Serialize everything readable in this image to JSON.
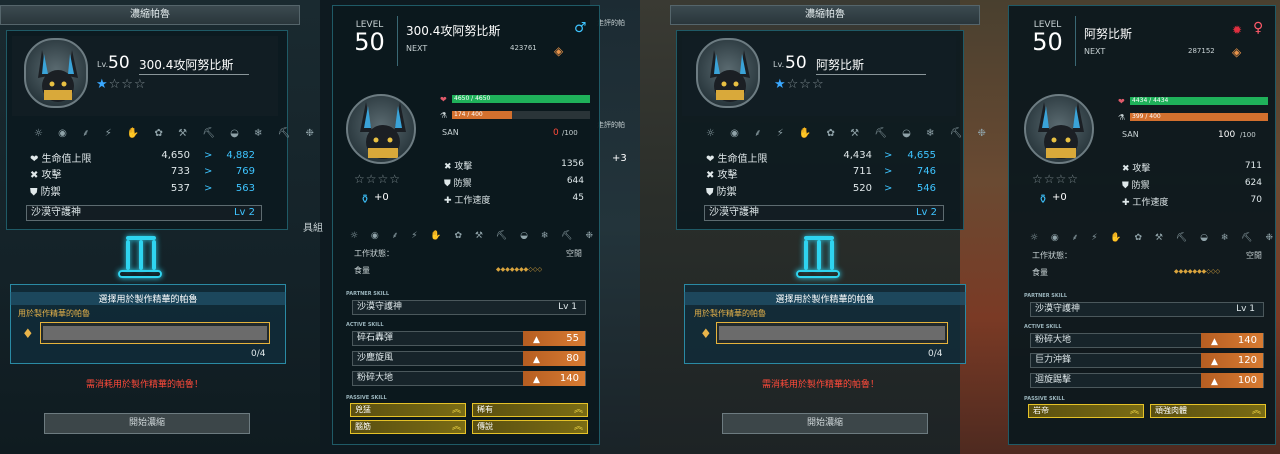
{
  "colors": {
    "accent": "#3ec4ff",
    "hp": "#1fb15a",
    "stamina": "#d3702e",
    "warning": "#ff4a3a",
    "gold": "#e5c228"
  },
  "left": {
    "title": "濃縮帕魯",
    "level_prefix": "Lv.",
    "level": "50",
    "name": "300.4攻阿努比斯",
    "stars": "★☆☆☆",
    "icon_row": "☼ ◉ ⸙ ⚡ ✋ ✿ ⚒ ⛏ ◒ ❄ ⛏ ❉",
    "stats": [
      {
        "label": "❤ 生命值上限",
        "cur": "4,650",
        "arrow": ">",
        "next": "4,882"
      },
      {
        "label": "✖ 攻擊",
        "cur": "733",
        "arrow": ">",
        "next": "769"
      },
      {
        "label": "⛊ 防禦",
        "cur": "537",
        "arrow": ">",
        "next": "563"
      }
    ],
    "partner_skill": {
      "name": "沙漠守護神",
      "lv": "Lv 2"
    },
    "select_title": "選擇用於製作精華的帕魯",
    "select_label": "用於製作精華的帕魯",
    "count": "0/4",
    "warning": "需消耗用於製作精華的帕魯！",
    "start_button": "開始濃縮"
  },
  "right": {
    "title": "濃縮帕魯",
    "level_prefix": "Lv.",
    "level": "50",
    "name": "阿努比斯",
    "stars": "★☆☆☆",
    "icon_row": "☼ ◉ ⸙ ⚡ ✋ ✿ ⚒ ⛏ ◒ ❄ ⛏ ❉",
    "stats": [
      {
        "label": "❤ 生命值上限",
        "cur": "4,434",
        "arrow": ">",
        "next": "4,655"
      },
      {
        "label": "✖ 攻擊",
        "cur": "711",
        "arrow": ">",
        "next": "746"
      },
      {
        "label": "⛊ 防禦",
        "cur": "520",
        "arrow": ">",
        "next": "546"
      }
    ],
    "partner_skill": {
      "name": "沙漠守護神",
      "lv": "Lv 2"
    },
    "select_title": "選擇用於製作精華的帕魯",
    "select_label": "用於製作精華的帕魯",
    "count": "0/4",
    "warning": "需消耗用於製作精華的帕魯！",
    "start_button": "開始濃縮"
  },
  "detail1": {
    "level_label": "LEVEL",
    "level": "50",
    "name": "300.4攻阿努比斯",
    "next_label": "NEXT",
    "next_value": "423761",
    "gender": "♂",
    "hp_text": "4650 / 4650",
    "stamina_text": "174 / 400",
    "san_label": "SAN",
    "san_value": "0",
    "san_max": "/100",
    "stars": "☆☆☆☆",
    "rank": "+0",
    "stats": [
      {
        "label": "✖ 攻擊",
        "value": "1356"
      },
      {
        "label": "⛊ 防禦",
        "value": "644"
      },
      {
        "label": "✚ 工作速度",
        "value": "45"
      }
    ],
    "work_status_label": "工作狀態：",
    "work_status": "空閒",
    "food_label": "食量",
    "food": "◆◆◆◆◆◆◆◇◇◇",
    "partner_label": "PARTNER SKILL",
    "partner_skill": {
      "name": "沙漠守護神",
      "lv": "Lv 1"
    },
    "active_label": "ACTIVE SKILL",
    "active": [
      {
        "name": "碎石轟彈",
        "power": "55"
      },
      {
        "name": "沙塵旋風",
        "power": "80"
      },
      {
        "name": "粉碎大地",
        "power": "140"
      }
    ],
    "passive_label": "PASSIVE SKILL",
    "passive": [
      "兇猛",
      "稀有",
      "腦筋",
      "傳說"
    ]
  },
  "detail2": {
    "level_label": "LEVEL",
    "level": "50",
    "name": "阿努比斯",
    "next_label": "NEXT",
    "next_value": "287152",
    "gender": "♀",
    "hp_text": "4434 / 4434",
    "stamina_text": "399 / 400",
    "san_label": "SAN",
    "san_value": "100",
    "san_max": "/100",
    "stars": "☆☆☆☆",
    "rank": "+0",
    "stats": [
      {
        "label": "✖ 攻擊",
        "value": "711"
      },
      {
        "label": "⛊ 防禦",
        "value": "624"
      },
      {
        "label": "✚ 工作速度",
        "value": "70"
      }
    ],
    "work_status_label": "工作狀態：",
    "work_status": "空閒",
    "food_label": "食量",
    "food": "◆◆◆◆◆◆◆◇◇◇",
    "partner_label": "PARTNER SKILL",
    "partner_skill": {
      "name": "沙漠守護神",
      "lv": "Lv 1"
    },
    "active_label": "ACTIVE SKILL",
    "active": [
      {
        "name": "粉碎大地",
        "power": "140"
      },
      {
        "name": "巨力沖鋒",
        "power": "120"
      },
      {
        "name": "迴旋踢擊",
        "power": "100"
      }
    ],
    "passive_label": "PASSIVE SKILL",
    "passive": [
      "岩帝",
      "頑強肉體"
    ]
  },
  "edge_text": {
    "a": "走評的帕",
    "b": "走評的帕",
    "c": "+3",
    "d": "具組"
  }
}
